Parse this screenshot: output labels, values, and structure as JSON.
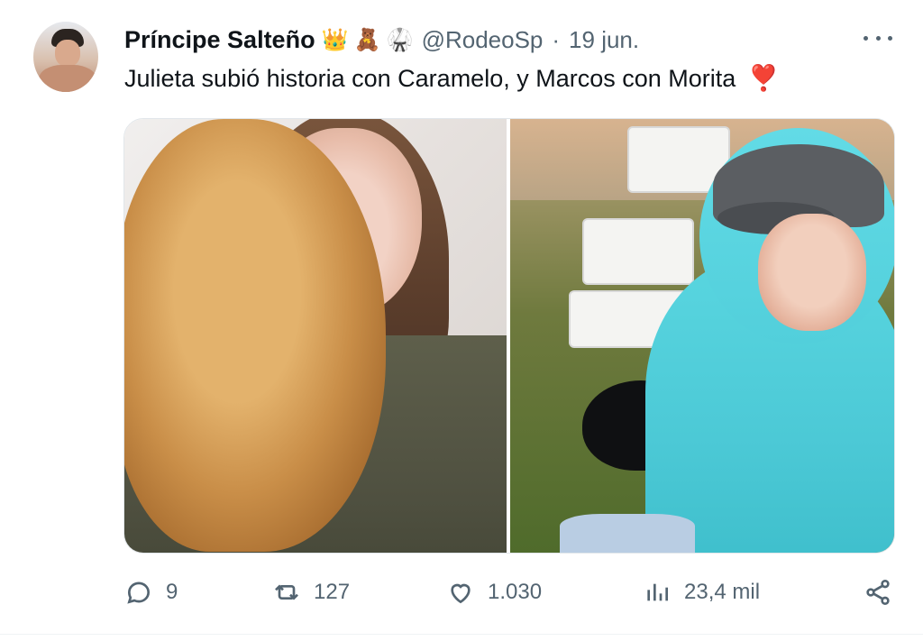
{
  "tweet": {
    "author": {
      "name": "Príncipe Salteño",
      "badges": [
        {
          "name": "crown-icon",
          "glyph": "👑"
        },
        {
          "name": "teddy-bear-icon",
          "glyph": "🧸"
        },
        {
          "name": "karate-uniform-icon",
          "glyph": "🥋"
        }
      ],
      "handle": "@RodeoSp",
      "separator": "·",
      "date": "19 jun."
    },
    "text": "Julieta subió historia con Caramelo, y Marcos con Morita",
    "text_emoji": "❣️",
    "media": {
      "count": 2
    },
    "actions": {
      "reply_count": "9",
      "retweet_count": "127",
      "like_count": "1.030",
      "views_count": "23,4 mil"
    }
  },
  "colors": {
    "text": "#0f1419",
    "muted": "#536471",
    "border": "#e1e6ea",
    "heart_emoji": "#e0245e"
  },
  "icons": {
    "more": "more-dots-icon",
    "reply": "reply-icon",
    "retweet": "retweet-icon",
    "like": "heart-icon",
    "views": "views-icon",
    "share": "share-icon"
  }
}
